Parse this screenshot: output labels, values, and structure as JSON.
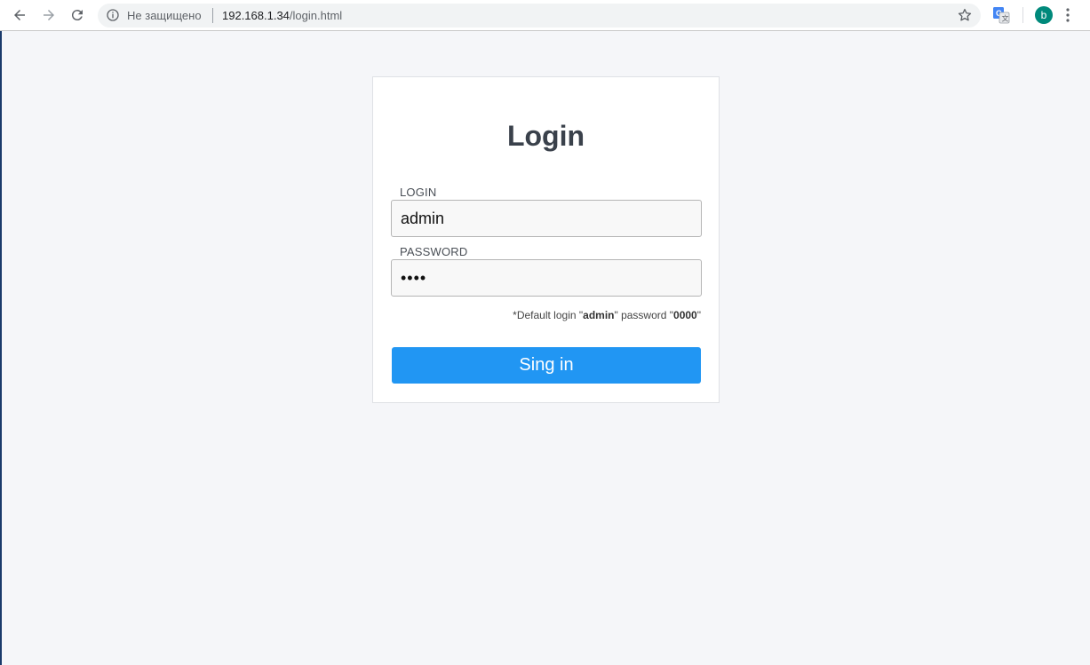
{
  "browser": {
    "security_label": "Не защищено",
    "url_host": "192.168.1.34",
    "url_path": "/login.html",
    "avatar_letter": "b",
    "icons": [
      "back-icon",
      "forward-icon",
      "reload-icon",
      "info-icon",
      "star-icon",
      "translate-icon",
      "menu-icon"
    ]
  },
  "login_card": {
    "title": "Login",
    "login_label": "LOGIN",
    "login_value": "admin",
    "password_label": "PASSWORD",
    "password_value": "••••",
    "hint_prefix": "*Default login \"",
    "hint_login": "admin",
    "hint_middle": "\" password \"",
    "hint_password": "0000",
    "hint_suffix": "\"",
    "submit_label": "Sing in"
  },
  "colors": {
    "accent": "#2196f3",
    "page_bg": "#f5f6f9",
    "avatar_bg": "#00897b"
  }
}
